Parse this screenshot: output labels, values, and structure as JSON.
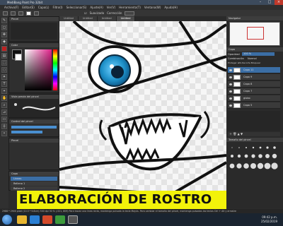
{
  "app": {
    "title": "MediBang Paint Pro 32bit"
  },
  "menu": [
    "Archivo(F)",
    "Editar(E)",
    "Capa(L)",
    "Filtro(I)",
    "Seleccionar(S)",
    "Ajuste(A)",
    "Ver(V)",
    "Herramienta(T)",
    "Ventana(W)",
    "Ayuda(H)"
  ],
  "toolbar": {
    "smooth_label": "Suavizado",
    "correction_label": "Corrección"
  },
  "tabs": [
    "Untitled",
    "Untitled",
    "Untitled",
    "Untitled"
  ],
  "left_panels": {
    "color_title": "Color",
    "brush_title": "Vista previa del pincel",
    "brush_size": "Control del pincel"
  },
  "right_panel": {
    "navigator_title": "Navigator",
    "layer_title": "Capa",
    "opacity_label": "Opacidad",
    "opacity_value": "100 %",
    "blend_label": "Combinación",
    "blend_value": "Normal",
    "protect_label": "Proteger alfa",
    "clip_label": "Recorte",
    "lock_label": "Bloquear",
    "layers": [
      "Capa 11",
      "Capa 9",
      "Capa 8",
      "Capa 7",
      "globo",
      "Capa 5"
    ],
    "brush_size_title": "Tamaño del pincel"
  },
  "left_layers": [
    "Lineas",
    "Relleno 1",
    "Relleno 2"
  ],
  "banner": "ELABORACIÓN DE ROSTRO",
  "status": "2988 * 2900 pixel  (10.5 * 9.8cm)  300 dpi  30 %   (-521, 809)   Para trazar una linea recta, mantenga pulsada la tecla Mayús. Para cambiar el tamaño del pincel, mantenga pulsadas las teclas Ctrl + Alt y arrastre",
  "clock": {
    "time": "09:42 p.m.",
    "date": "25/02/2019"
  },
  "colors": {
    "accent": "#3b6ea5",
    "banner": "#f2f20a",
    "eye": "#1e90c8"
  }
}
